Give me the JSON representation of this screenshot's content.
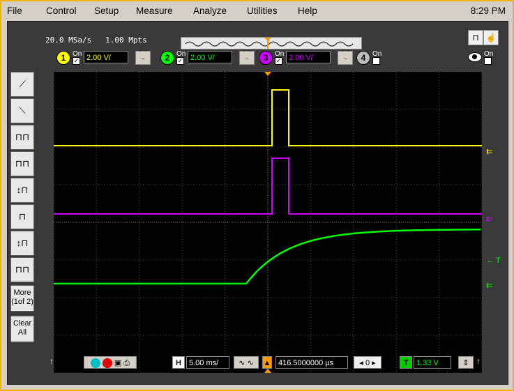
{
  "menu": {
    "file": "File",
    "control": "Control",
    "setup": "Setup",
    "measure": "Measure",
    "analyze": "Analyze",
    "utilities": "Utilities",
    "help": "Help",
    "clock": "8:29 PM"
  },
  "acquisition": {
    "sample_rate": "20.0 MSa/s",
    "memory_depth": "1.00 Mpts"
  },
  "channels": [
    {
      "number": "1",
      "on_label": "On",
      "checked": true,
      "scale": "2.00 V/",
      "color": "#ffff00"
    },
    {
      "number": "2",
      "on_label": "On",
      "checked": true,
      "scale": "2.00 V/",
      "color": "#00ff00"
    },
    {
      "number": "3",
      "on_label": "On",
      "checked": true,
      "scale": "2.00 V/",
      "color": "#cc00ff"
    },
    {
      "number": "4",
      "on_label": "On",
      "checked": false,
      "scale": "",
      "color": "#888888"
    }
  ],
  "display_toggle": {
    "on_label": "On"
  },
  "softkeys": {
    "more": "More\n(1of 2)",
    "clear": "Clear\nAll"
  },
  "timebase": {
    "h_label": "H",
    "scale": "5.00 ms/",
    "delay": "416.5000000 µs",
    "zero": "0",
    "trigger_label": "T",
    "trigger_level": "1.33 V"
  },
  "markers": {
    "trigger": "T"
  },
  "colors": {
    "frame_border": "#f2b200",
    "ch1": "#ffff00",
    "ch2": "#00ff00",
    "ch3": "#cc00ff",
    "grid": "#555555",
    "trigger_marker": "#ff9900"
  }
}
